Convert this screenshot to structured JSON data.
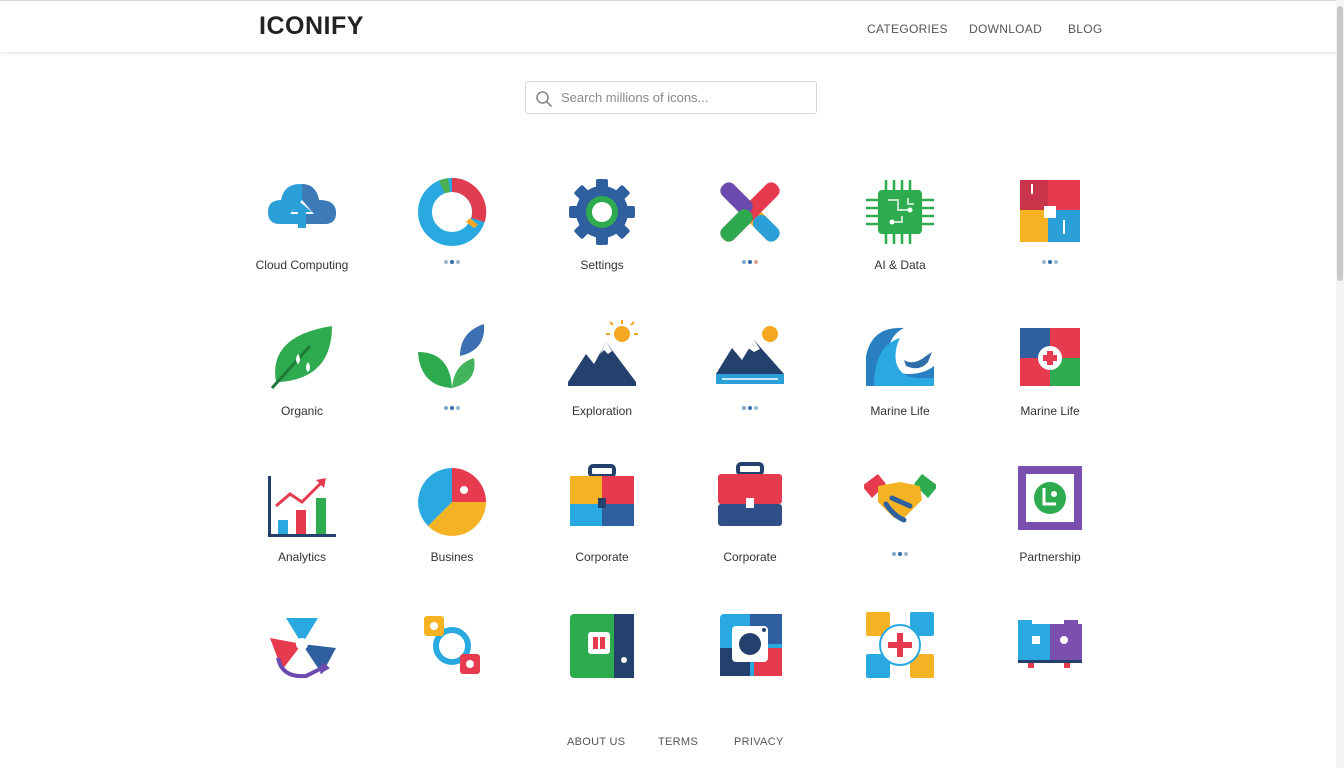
{
  "header": {
    "logo": "ICONIFY",
    "nav": [
      "CATEGORIES",
      "DOWNLOAD",
      "BLOG"
    ]
  },
  "search": {
    "placeholder": "Search millions of icons...",
    "value": ""
  },
  "grid": [
    {
      "icon": "cloud-upload-icon",
      "label": "Cloud Computing"
    },
    {
      "icon": "donut-chart-icon",
      "label": ""
    },
    {
      "icon": "gear-icon",
      "label": "Settings"
    },
    {
      "icon": "crossed-x-icon",
      "label": ""
    },
    {
      "icon": "circuit-chip-icon",
      "label": "AI & Data"
    },
    {
      "icon": "puzzle-tiles-icon",
      "label": ""
    },
    {
      "icon": "leaf-drops-icon",
      "label": "Organic"
    },
    {
      "icon": "sprout-icon",
      "label": ""
    },
    {
      "icon": "mountain-sun-icon",
      "label": "Exploration"
    },
    {
      "icon": "mountain-lake-icon",
      "label": ""
    },
    {
      "icon": "wave-whale-icon",
      "label": "Marine Life"
    },
    {
      "icon": "medical-puzzle-icon",
      "label": "Marine Life"
    },
    {
      "icon": "bar-chart-icon",
      "label": "Analytics"
    },
    {
      "icon": "pie-chart-icon",
      "label": "Busines"
    },
    {
      "icon": "briefcase-color-icon",
      "label": "Corporate"
    },
    {
      "icon": "briefcase-icon",
      "label": "Corporate"
    },
    {
      "icon": "handshake-icon",
      "label": ""
    },
    {
      "icon": "partnership-frame-icon",
      "label": "Partnership"
    },
    {
      "icon": "recycle-arrows-icon",
      "label": ""
    },
    {
      "icon": "link-nodes-icon",
      "label": ""
    },
    {
      "icon": "green-box-icon",
      "label": ""
    },
    {
      "icon": "blue-box-icon",
      "label": ""
    },
    {
      "icon": "medical-cross-icon",
      "label": ""
    },
    {
      "icon": "monitor-folder-icon",
      "label": ""
    }
  ],
  "footer": {
    "links": [
      "ABOUT US",
      "TERMS",
      "PRIVACY"
    ]
  }
}
